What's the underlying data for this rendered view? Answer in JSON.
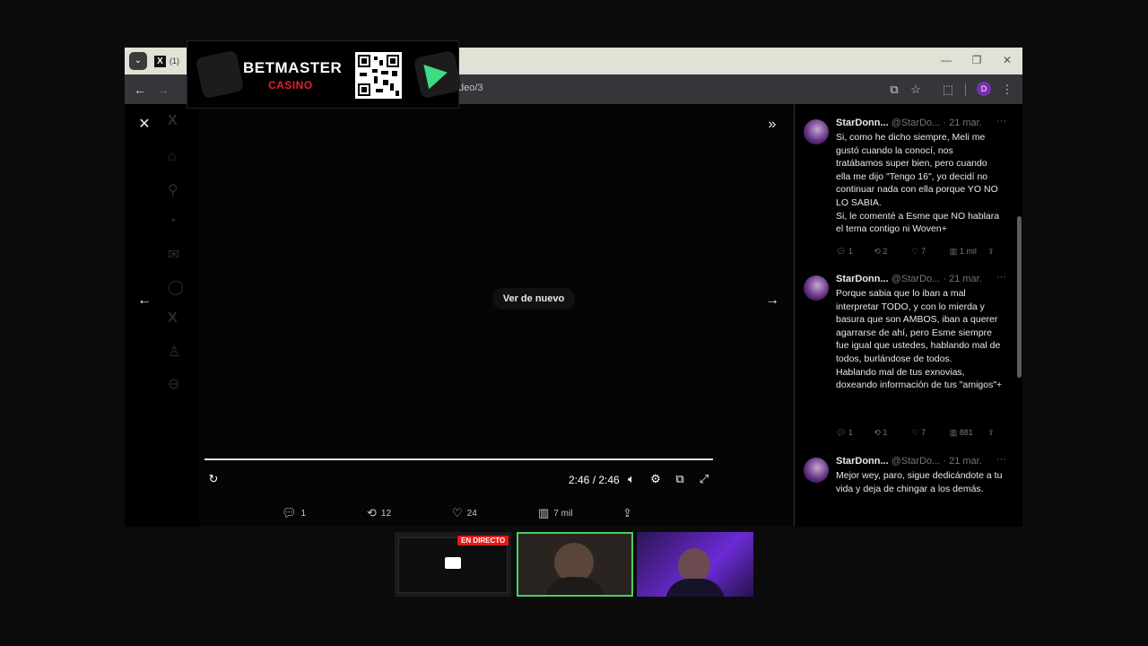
{
  "browser": {
    "tab_label": "(1) ",
    "url": "deo/3",
    "profile_initial": "D"
  },
  "ad": {
    "brand": "BETMASTER",
    "sub": "CASINO"
  },
  "video": {
    "replay_label": "Ver de nuevo",
    "time": "2:46 / 2:46",
    "progress": 1.0
  },
  "actions": {
    "replies": "1",
    "reposts": "12",
    "likes": "24",
    "views": "7 mil"
  },
  "replies": [
    {
      "name": "StarDonn...",
      "handle": "@StarDo...",
      "date": "· 21 mar.",
      "text": "Si, como he dicho siempre, Meli me gustó cuando la conocí, nos tratábamos super bien, pero cuando ella me dijo \"Tengo 16\", yo decidí no continuar nada con ella porque YO NO LO SABIA.\nSi, le comenté a Esme que NO hablara el tema contigo ni Woven+",
      "stats": {
        "replies": "1",
        "reposts": "2",
        "likes": "7",
        "views": "1 mil"
      }
    },
    {
      "name": "StarDonn...",
      "handle": "@StarDo...",
      "date": "· 21 mar.",
      "text": "Porque sabia que lo iban a mal interpretar TODO, y con lo mierda y basura que son AMBOS, iban a querer agarrarse de ahí, pero Esme siempre fue igual que ustedes, hablando mal de todos, burlándose de todos.\nHablando mal de tus exnovias, doxeando información de tus \"amigos\"+",
      "stats": {
        "replies": "1",
        "reposts": "1",
        "likes": "7",
        "views": "881"
      }
    },
    {
      "name": "StarDonn...",
      "handle": "@StarDo...",
      "date": "· 21 mar.",
      "text": "Mejor wey, paro, sigue dedicándote a tu vida y deja de chingar a los demás.",
      "stats": {
        "replies": "",
        "reposts": "",
        "likes": "",
        "views": ""
      }
    }
  ],
  "stream": {
    "live_badge": "EN DIRECTO"
  },
  "colors": {
    "accent_green": "#46d160",
    "live_red": "#e91916"
  }
}
